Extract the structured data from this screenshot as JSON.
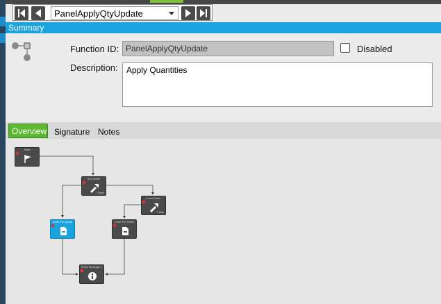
{
  "nav": {
    "selected_function": "PanelApplyQtyUpdate"
  },
  "summary": {
    "header": "Summary",
    "function_id_label": "Function ID:",
    "function_id_value": "PanelApplyQtyUpdate",
    "disabled_label": "Disabled",
    "disabled_checked": false,
    "description_label": "Description:",
    "description_value": "Apply Quantities"
  },
  "tabs": [
    {
      "label": "Overview",
      "active": true
    },
    {
      "label": "Signature",
      "active": false
    },
    {
      "label": "Notes",
      "active": false
    }
  ],
  "diagram": {
    "nodes": [
      {
        "id": "start",
        "title": "Start",
        "icon": "flag-icon"
      },
      {
        "id": "is-quote",
        "title": "Is a Quote",
        "icon": "branch-icon",
        "footer": "False"
      },
      {
        "id": "is-an-order",
        "title": "Is an Order",
        "icon": "branch-icon",
        "footer": "False"
      },
      {
        "id": "code-for-quote",
        "title": "Code For Quote",
        "icon": "code-icon",
        "selected": true
      },
      {
        "id": "code-for-order",
        "title": "Code For Order",
        "icon": "code-icon"
      },
      {
        "id": "show-message",
        "title": "Show Message 1",
        "icon": "info-icon"
      }
    ]
  },
  "colors": {
    "accent_blue": "#1aa3dc",
    "accent_green": "#5cb82f",
    "node_dark": "#4a4a4a"
  }
}
